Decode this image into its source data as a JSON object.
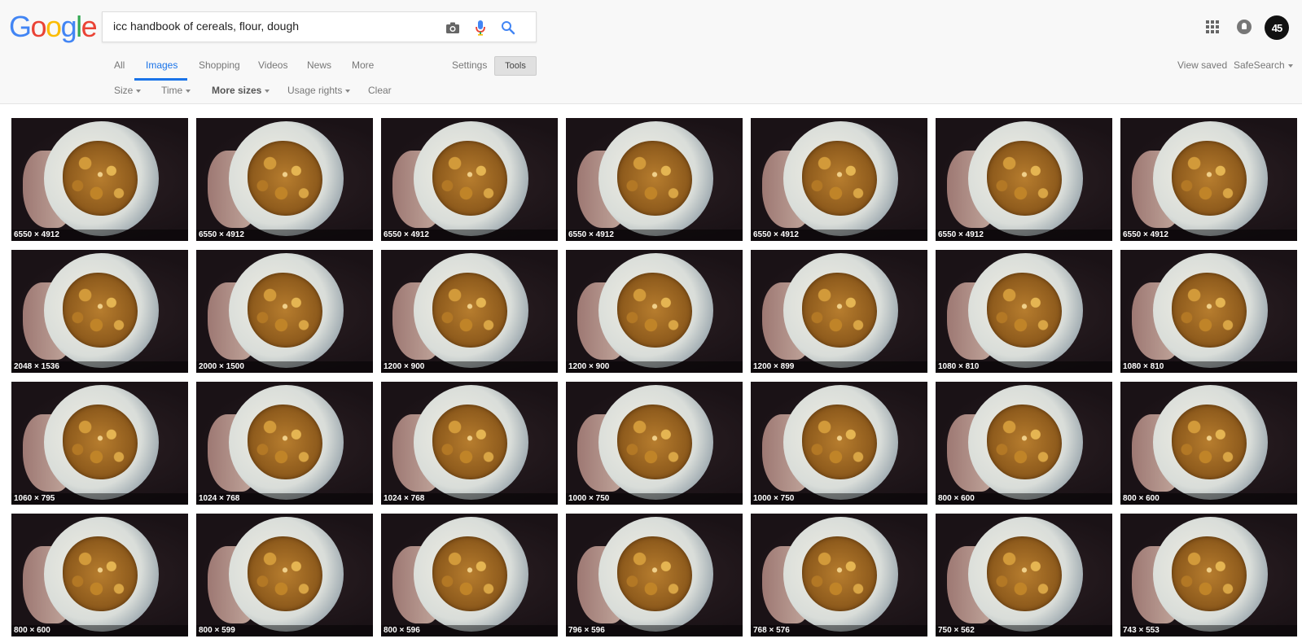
{
  "logo": {
    "letters": [
      "G",
      "o",
      "o",
      "g",
      "l",
      "e"
    ]
  },
  "search": {
    "value": "icc handbook of cereals, flour, dough"
  },
  "nav": {
    "all": "All",
    "images": "Images",
    "shopping": "Shopping",
    "videos": "Videos",
    "news": "News",
    "more": "More",
    "settings": "Settings",
    "tools": "Tools"
  },
  "toolbar": {
    "size": "Size",
    "time": "Time",
    "more_sizes": "More sizes",
    "usage_rights": "Usage rights",
    "clear": "Clear"
  },
  "right_links": {
    "view_saved": "View saved",
    "safesearch": "SafeSearch"
  },
  "account": {
    "avatar_text": "45"
  },
  "colors": {
    "active_tab": "#1a73e8",
    "header_bg": "#f8f8f8"
  },
  "results": [
    [
      "6550 × 4912",
      "6550 × 4912",
      "6550 × 4912",
      "6550 × 4912",
      "6550 × 4912",
      "6550 × 4912",
      "6550 × 4912"
    ],
    [
      "2048 × 1536",
      "2000 × 1500",
      "1200 × 900",
      "1200 × 900",
      "1200 × 899",
      "1080 × 810",
      "1080 × 810"
    ],
    [
      "1060 × 795",
      "1024 × 768",
      "1024 × 768",
      "1000 × 750",
      "1000 × 750",
      "800 × 600",
      "800 × 600"
    ],
    [
      "800 × 600",
      "800 × 599",
      "800 × 596",
      "796 × 596",
      "768 × 576",
      "750 × 562",
      "743 × 553"
    ]
  ]
}
